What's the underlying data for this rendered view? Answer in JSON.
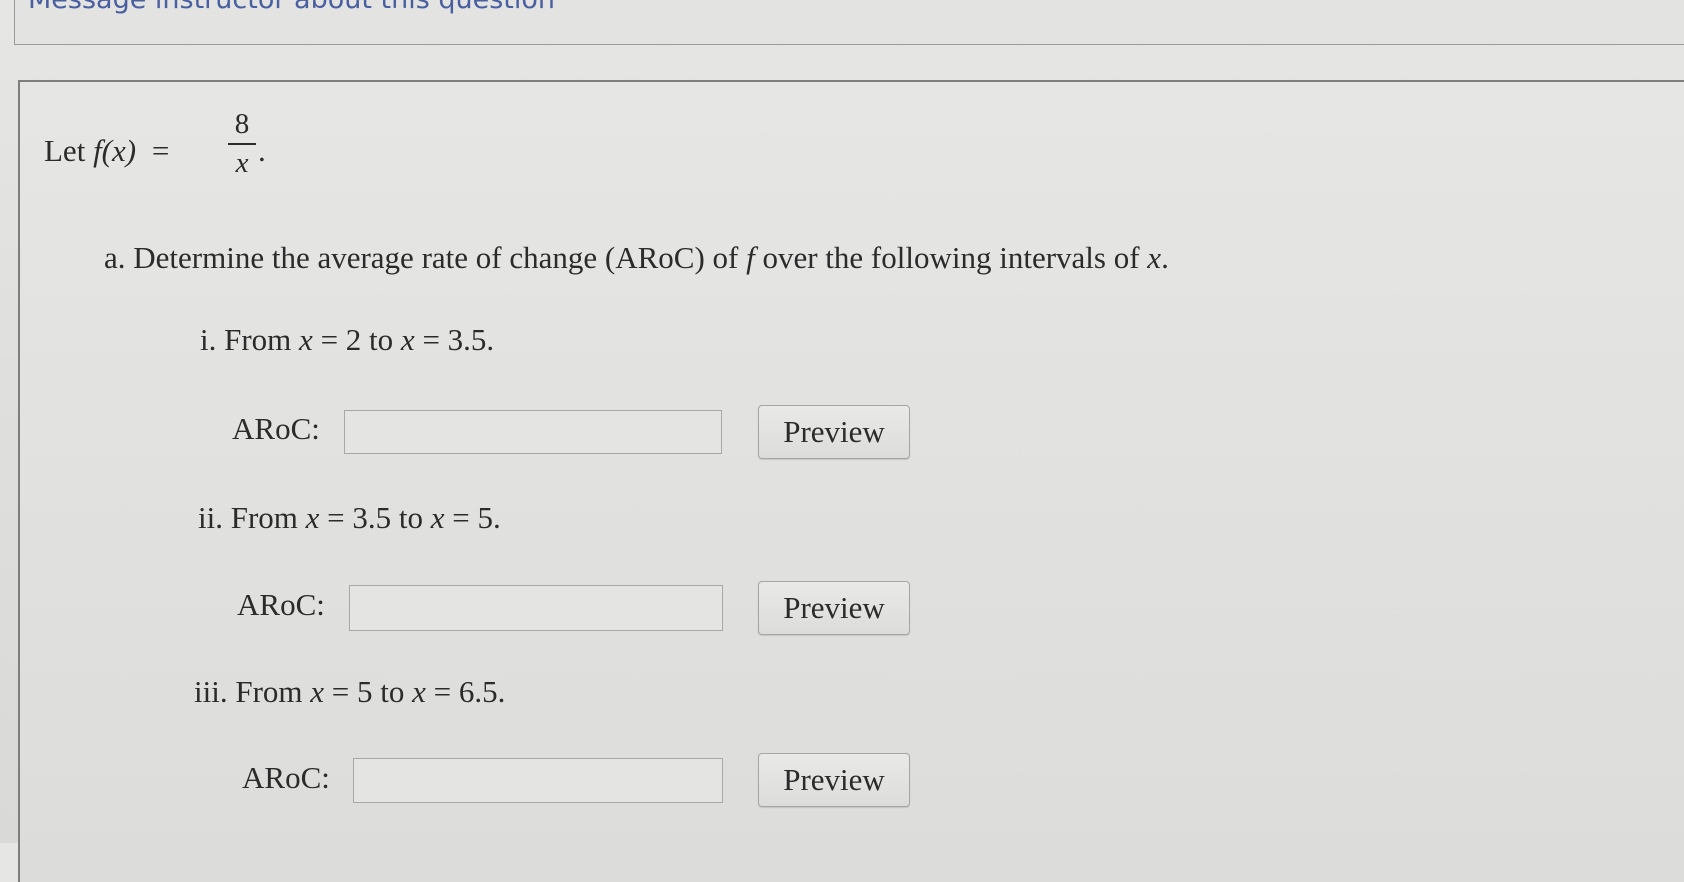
{
  "header": {
    "link_text": "Message instructor about this question"
  },
  "question": {
    "intro_prefix": "Let ",
    "f_of_x": "f(x)",
    "equals": "=",
    "fraction_numerator": "8",
    "fraction_denominator": "x",
    "period": ".",
    "part_a_prefix": "a. Determine the average rate of change (ARoC) of ",
    "part_a_f": "f",
    "part_a_middle": " over the following intervals of ",
    "part_a_x": "x",
    "part_a_end": "."
  },
  "items": [
    {
      "roman": "i. From ",
      "var1": "x",
      "eq1": " = 2 to ",
      "var2": "x",
      "eq2": " = 3.5.",
      "answer_label": "ARoC:",
      "answer_value": "",
      "preview_label": "Preview"
    },
    {
      "roman": "ii. From ",
      "var1": "x",
      "eq1": " = 3.5 to ",
      "var2": "x",
      "eq2": " = 5.",
      "answer_label": "ARoC:",
      "answer_value": "",
      "preview_label": "Preview"
    },
    {
      "roman": "iii. From ",
      "var1": "x",
      "eq1": " = 5 to ",
      "var2": "x",
      "eq2": " = 6.5.",
      "answer_label": "ARoC:",
      "answer_value": "",
      "preview_label": "Preview"
    }
  ],
  "colors": {
    "link": "#4a5fa0",
    "text": "#2b2b2b",
    "border": "#9a9a9a"
  }
}
